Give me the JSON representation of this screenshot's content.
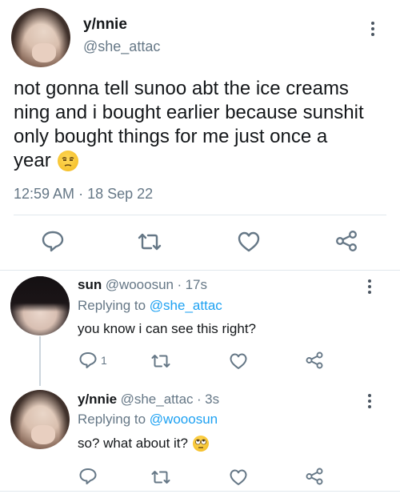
{
  "main_tweet": {
    "name": "y/nnie",
    "handle": "@she_attac",
    "text_lines": [
      "not gonna tell sunoo abt the ice creams",
      "ning and i bought earlier because sunshit",
      "only bought things for me just once a",
      "year"
    ],
    "emoji": "unamused-face-emoji",
    "time": "12:59 AM",
    "separator": "·",
    "date": "18 Sep 22"
  },
  "replies": [
    {
      "name": "sun",
      "handle": "@wooosun",
      "separator": "·",
      "age": "17s",
      "replying_prefix": "Replying to",
      "replying_to": "@she_attac",
      "text": "you know i can see this right?",
      "reply_count": "1"
    },
    {
      "name": "y/nnie",
      "handle": "@she_attac",
      "separator": "·",
      "age": "3s",
      "replying_prefix": "Replying to",
      "replying_to": "@wooosun",
      "text": "so? what about it?",
      "emoji": "face-with-rolling-eyes-emoji"
    }
  ],
  "colors": {
    "text": "#14171a",
    "secondary": "#657786",
    "link": "#1da1f2",
    "divider": "#e1e8ed",
    "icon": "#657786"
  }
}
